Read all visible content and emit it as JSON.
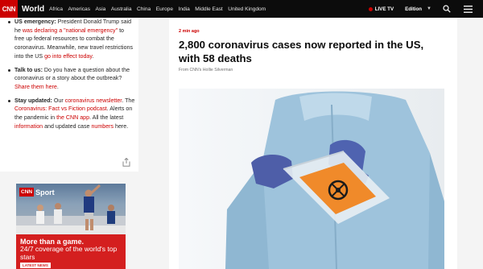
{
  "nav": {
    "logo": "CNN",
    "section": "World",
    "links": [
      "Africa",
      "Americas",
      "Asia",
      "Australia",
      "China",
      "Europe",
      "India",
      "Middle East",
      "United Kingdom"
    ],
    "live_tv": "LIVE TV",
    "edition": "Edition",
    "icons": [
      "search-icon",
      "menu-icon"
    ],
    "accent": "#cc0000"
  },
  "sidebar": {
    "bullet1": {
      "lead": "US emergency:",
      "t1": " President Donald Trump said he ",
      "link1": "was declaring a \"national emergency\"",
      "t2": " to free up federal resources to combat the coronavirus. Meanwhile, new travel restrictions into the US ",
      "link2": "go into effect today",
      "t3": "."
    },
    "bullet2": {
      "lead": "Talk to us:",
      "t1": " Do you have a question about the coronavirus or a story about the outbreak? ",
      "link1": "Share them here",
      "t2": "."
    },
    "bullet3": {
      "lead": "Stay updated:",
      "t1": " Our ",
      "link1": "coronavirus newsletter",
      "t2": ". The ",
      "link2": "Coronavirus: Fact vs Fiction podcast",
      "t3": ". Alerts on the pandemic in ",
      "link3": "the CNN app",
      "t4": ". All the latest ",
      "link4": "information",
      "t5": " and updated case ",
      "link5": "numbers",
      "t6": " here."
    },
    "share_icon": "share-icon"
  },
  "ad": {
    "logo": "CNN",
    "brand": "Sport",
    "line1": "More than a game.",
    "line2": "24/7 coverage of the world's top stars",
    "cta": "LATEST NEWS"
  },
  "article": {
    "time": "2 min ago",
    "headline": "2,800 coronavirus cases now reported in the US, with 58 deaths",
    "byline": "From CNN's Hollie Silverman"
  }
}
